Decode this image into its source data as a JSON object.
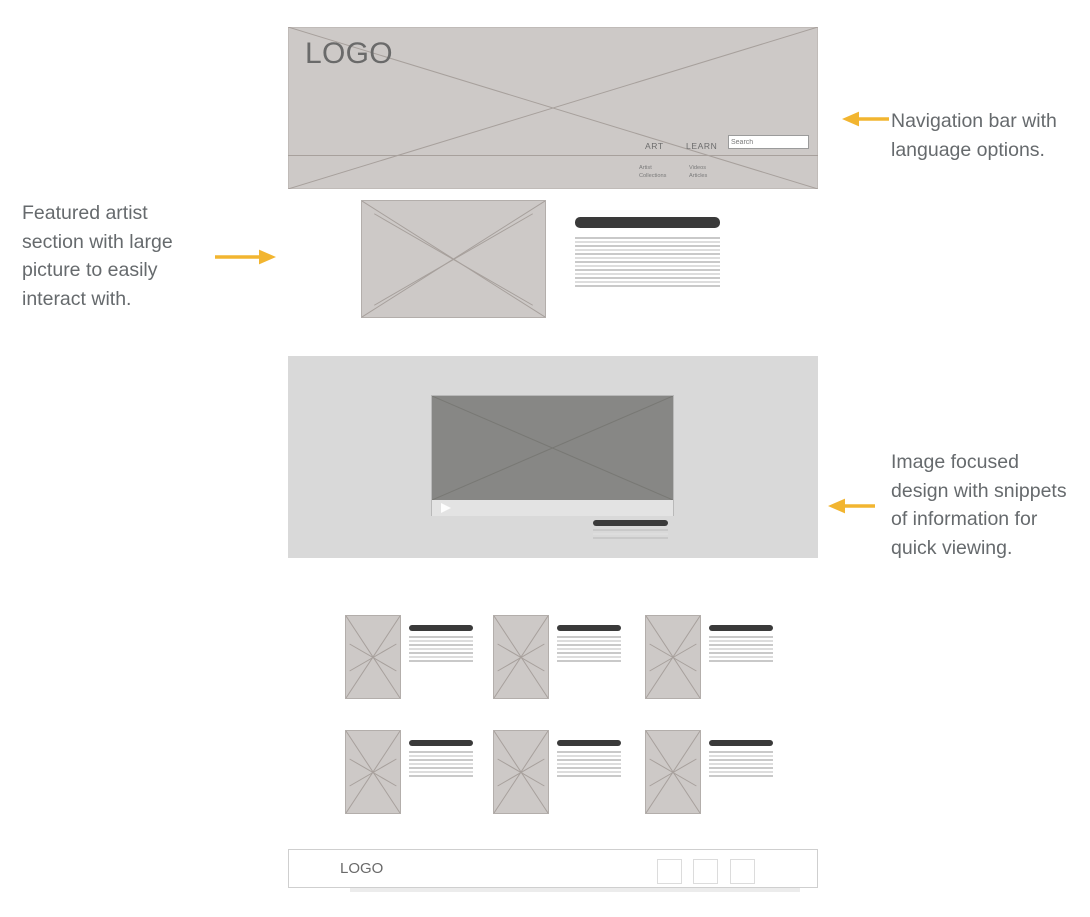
{
  "colors": {
    "arrow": "#f2b530",
    "annotation_text": "#666a6d",
    "wireframe_fill": "#cdc9c7",
    "wireframe_stroke": "#a7a09c",
    "band_light": "#d9d9d9",
    "video_screen": "#878785",
    "title_bar": "#3a3a3a",
    "text_line": "#c9c9c9",
    "logo_text": "#6a6a6a"
  },
  "header": {
    "logo": "LOGO",
    "nav": [
      {
        "label": "ART",
        "submenu": "Artist\nCollections"
      },
      {
        "label": "LEARN",
        "submenu": "Videos\nArticles"
      }
    ],
    "nav_items": [
      {
        "label": "ART"
      },
      {
        "label": "LEARN"
      }
    ],
    "submenus": [
      {
        "items": [
          "Artist",
          "Collections"
        ]
      },
      {
        "items": [
          "Videos",
          "Articles"
        ]
      }
    ],
    "search": {
      "placeholder": "Search",
      "value": ""
    }
  },
  "featured": {
    "image_alt": "image-placeholder",
    "title_bar": "",
    "body_line_count": 13
  },
  "video": {
    "play_label": "",
    "caption_title": "",
    "caption_line_count": 3
  },
  "cards": [
    {
      "title": "",
      "line_count": 7
    },
    {
      "title": "",
      "line_count": 7
    },
    {
      "title": "",
      "line_count": 7
    },
    {
      "title": "",
      "line_count": 7
    },
    {
      "title": "",
      "line_count": 7
    },
    {
      "title": "",
      "line_count": 7
    }
  ],
  "footer": {
    "logo": "LOGO",
    "social_boxes": [
      "",
      "",
      ""
    ]
  },
  "annotations": {
    "left": "Featured artist section with large picture to easily interact with.",
    "right_top": "Navigation bar with language options.",
    "right_bottom": "Image focused design with snippets of information for quick viewing."
  }
}
